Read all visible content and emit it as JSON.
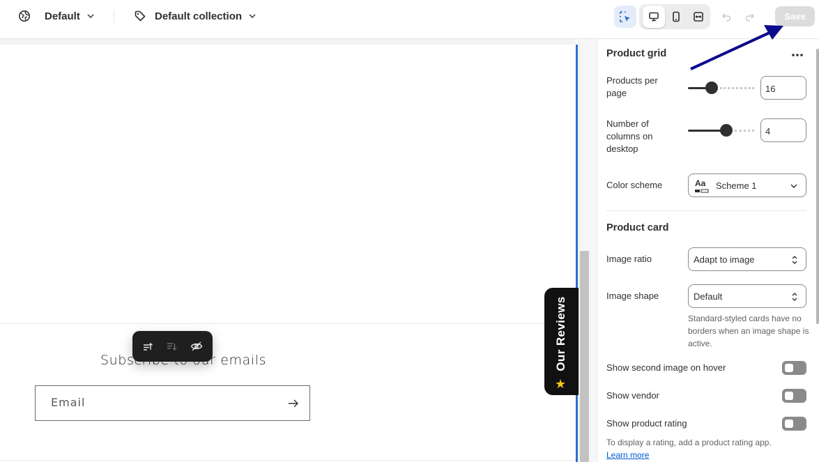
{
  "topbar": {
    "theme_label": "Default",
    "template_label": "Default collection",
    "save_label": "Save"
  },
  "preview": {
    "subscribe_title": "Subscribe to our emails",
    "email_placeholder": "Email",
    "reviews_tab_label": "Our Reviews",
    "reviews_star": "★"
  },
  "panel": {
    "product_grid": {
      "title": "Product grid",
      "products_per_page_label": "Products per page",
      "products_per_page_value": "16",
      "products_per_page_slider_fraction": 0.33,
      "columns_label": "Number of columns on desktop",
      "columns_value": "4",
      "columns_slider_fraction": 0.6,
      "color_scheme_label": "Color scheme",
      "color_scheme_value": "Scheme 1",
      "color_scheme_icon_text": "Aa"
    },
    "product_card": {
      "title": "Product card",
      "image_ratio_label": "Image ratio",
      "image_ratio_value": "Adapt to image",
      "image_shape_label": "Image shape",
      "image_shape_value": "Default",
      "image_shape_help": "Standard-styled cards have no borders when an image shape is active.",
      "second_image_label": "Show second image on hover",
      "vendor_label": "Show vendor",
      "rating_label": "Show product rating",
      "rating_help": "To display a rating, add a product rating app.",
      "learn_more": "Learn more"
    }
  },
  "colors": {
    "accent": "#2c6ecb",
    "annotation_arrow": "#0a0a8c",
    "star": "#f5c518"
  }
}
